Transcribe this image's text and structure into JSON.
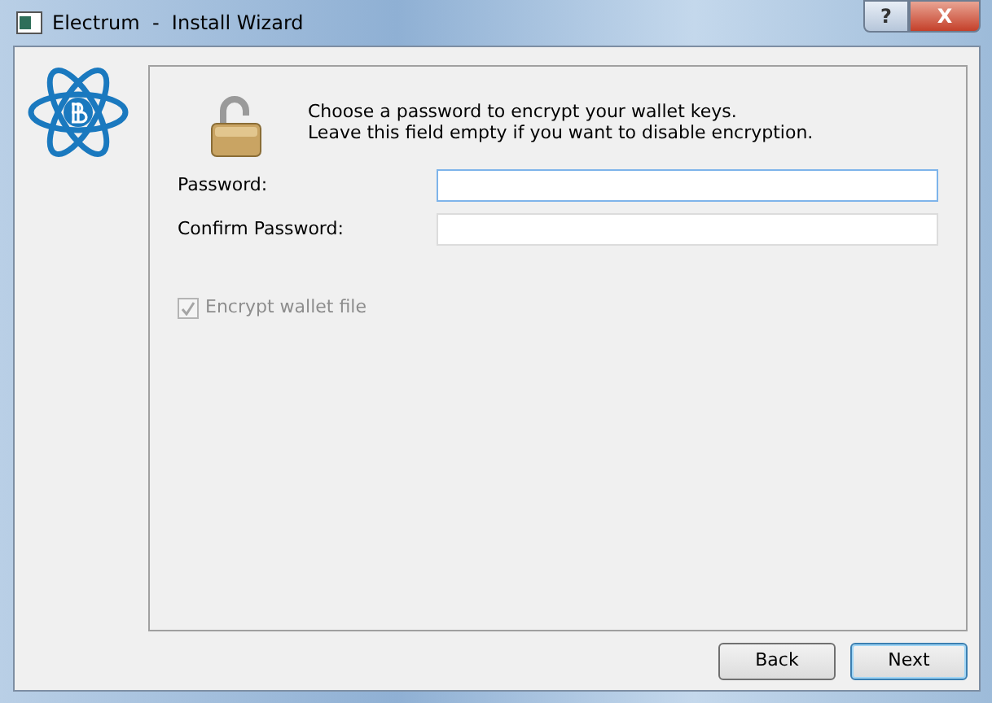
{
  "window": {
    "title": "Electrum  -  Install Wizard",
    "controls": [
      "?",
      "X"
    ]
  },
  "intro": [
    "Choose a password to encrypt your wallet keys.",
    "Leave this field empty if you want to disable encryption."
  ],
  "fields": [
    {
      "label": "Password:",
      "focused": true
    },
    {
      "label": "Confirm Password:",
      "focused": false
    }
  ],
  "checkbox": {
    "label": "Encrypt wallet file",
    "checked": true,
    "disabled": true
  },
  "buttons": [
    {
      "label": "Back",
      "default": false
    },
    {
      "label": "Next",
      "default": true
    }
  ]
}
